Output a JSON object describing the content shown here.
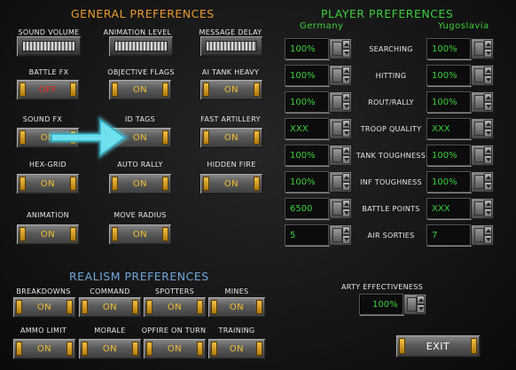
{
  "headers": {
    "general": "GENERAL PREFERENCES",
    "player": "PLAYER PREFERENCES",
    "realism": "REALISM PREFERENCES"
  },
  "players": {
    "left": "Germany",
    "right": "Yugoslavia"
  },
  "general": {
    "sound_volume": {
      "label": "SOUND VOLUME"
    },
    "animation_level": {
      "label": "ANIMATION LEVEL"
    },
    "message_delay": {
      "label": "MESSAGE DELAY"
    },
    "battle_fx": {
      "label": "BATTLE FX",
      "value": "OFF"
    },
    "objective_flags": {
      "label": "OBJECTIVE FLAGS",
      "value": "ON"
    },
    "ai_tank_heavy": {
      "label": "AI TANK HEAVY",
      "value": "ON"
    },
    "sound_fx": {
      "label": "SOUND FX",
      "value": "ON"
    },
    "id_tags": {
      "label": "ID TAGS",
      "value": "ON"
    },
    "fast_artillery": {
      "label": "FAST ARTILLERY",
      "value": "ON"
    },
    "hex_grid": {
      "label": "HEX-GRID",
      "value": "ON"
    },
    "auto_rally": {
      "label": "AUTO RALLY",
      "value": "ON"
    },
    "hidden_fire": {
      "label": "HIDDEN FIRE",
      "value": "ON"
    },
    "animation": {
      "label": "ANIMATION",
      "value": "ON"
    },
    "move_radius": {
      "label": "MOVE RADIUS",
      "value": "ON"
    }
  },
  "player_rows": [
    {
      "label": "SEARCHING",
      "left": "100%",
      "right": "100%"
    },
    {
      "label": "HITTING",
      "left": "100%",
      "right": "100%"
    },
    {
      "label": "ROUT/RALLY",
      "left": "100%",
      "right": "100%"
    },
    {
      "label": "TROOP QUALITY",
      "left": "XXX",
      "right": "XXX"
    },
    {
      "label": "TANK TOUGHNESS",
      "left": "100%",
      "right": "100%"
    },
    {
      "label": "INF TOUGHNESS",
      "left": "100%",
      "right": "100%"
    },
    {
      "label": "BATTLE POINTS",
      "left": "6500",
      "right": "XXX"
    },
    {
      "label": "AIR SORTIES",
      "left": "5",
      "right": "7"
    }
  ],
  "realism": {
    "breakdowns": {
      "label": "BREAKDOWNS",
      "value": "ON"
    },
    "command": {
      "label": "COMMAND",
      "value": "ON"
    },
    "spotters": {
      "label": "SPOTTERS",
      "value": "ON"
    },
    "mines": {
      "label": "MINES",
      "value": "ON"
    },
    "ammo_limit": {
      "label": "AMMO LIMIT",
      "value": "ON"
    },
    "morale": {
      "label": "MORALE",
      "value": "ON"
    },
    "opfire_on_turn": {
      "label": "OPFIRE ON TURN",
      "value": "ON"
    },
    "training": {
      "label": "TRAINING",
      "value": "ON"
    }
  },
  "arty": {
    "label": "ARTY EFFECTIVENESS",
    "value": "100%"
  },
  "exit": {
    "label": "EXIT"
  },
  "colors": {
    "orange_header": "#e89a30",
    "green_header": "#3ccf3c",
    "blue_header": "#6fa8d8",
    "on_text": "#f0c030",
    "off_text": "#e83020",
    "value_text": "#3ccf3c",
    "arrow": "#5ad8e8"
  },
  "icons": [
    "pointer-arrow-icon",
    "spinner-up-icon",
    "spinner-down-icon"
  ]
}
